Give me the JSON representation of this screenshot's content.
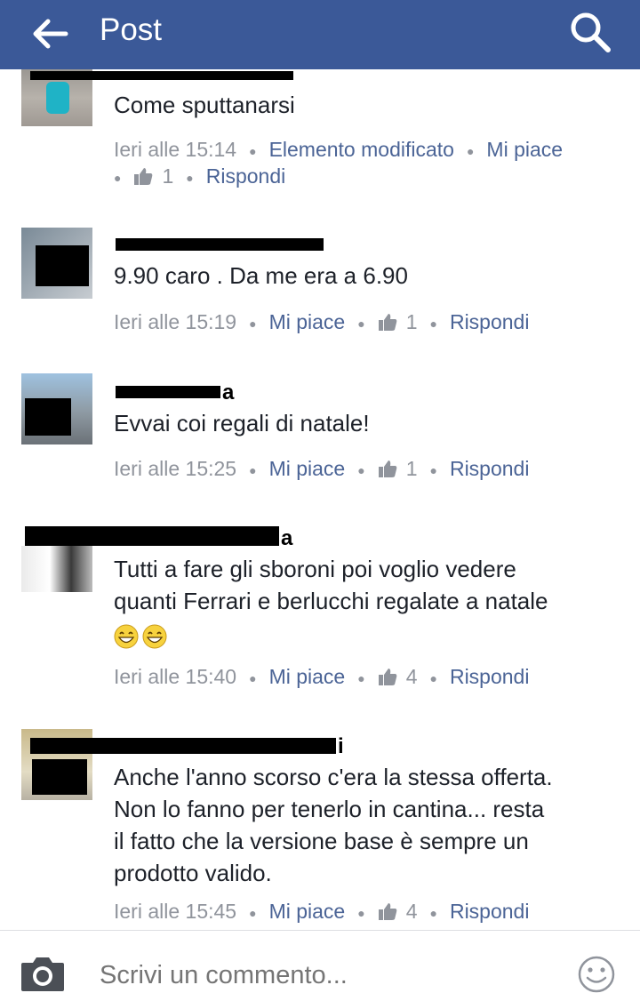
{
  "header": {
    "title": "Post",
    "back_icon": "arrow-left-icon",
    "search_icon": "search-icon"
  },
  "colors": {
    "header_bg": "#3b5998",
    "link": "#4b6496",
    "meta": "#90949c",
    "text": "#1d2129"
  },
  "comments": [
    {
      "text": "Come sputtanarsi",
      "time": "Ieri alle 15:14",
      "edited": "Elemento modificato",
      "like": "Mi piace",
      "likes": "1",
      "reply": "Rispondi"
    },
    {
      "text": "9.90 caro . Da me era a 6.90",
      "time": "Ieri alle 15:19",
      "like": "Mi piace",
      "likes": "1",
      "reply": "Rispondi"
    },
    {
      "name_tail": "a",
      "text": "Evvai coi regali di natale!",
      "time": "Ieri alle 15:25",
      "like": "Mi piace",
      "likes": "1",
      "reply": "Rispondi"
    },
    {
      "name_tail": "a",
      "text_lines": [
        "Tutti a fare gli sboroni poi voglio vedere",
        "quanti Ferrari e berlucchi regalate a natale"
      ],
      "emoji": "😁😁",
      "time": "Ieri alle 15:40",
      "like": "Mi piace",
      "likes": "4",
      "reply": "Rispondi"
    },
    {
      "name_tail": "i",
      "text_lines": [
        "Anche l'anno scorso c'era la stessa offerta.",
        "Non lo fanno per tenerlo in cantina... resta",
        "il fatto che la versione base è sempre un",
        "prodotto valido."
      ],
      "time": "Ieri alle 15:45",
      "like": "Mi piace",
      "likes": "4",
      "reply": "Rispondi"
    }
  ],
  "composer": {
    "placeholder": "Scrivi un commento...",
    "camera_icon": "camera-icon",
    "emoji_icon": "smiley-icon"
  }
}
